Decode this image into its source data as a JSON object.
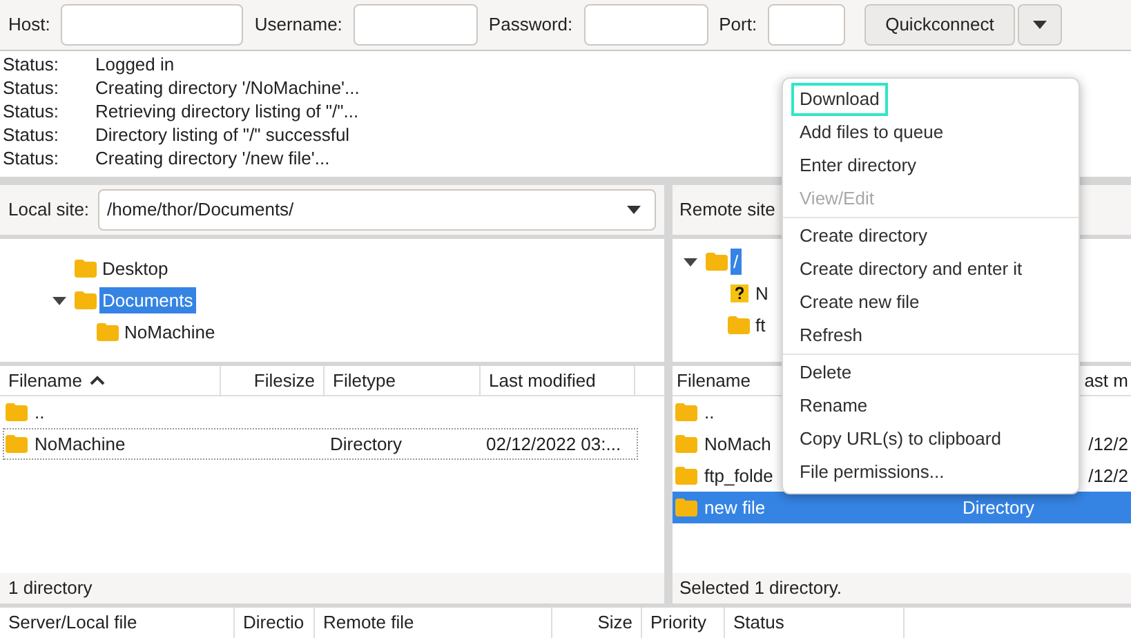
{
  "toolbar": {
    "fields": [
      {
        "label": "Host:"
      },
      {
        "label": "Username:"
      },
      {
        "label": "Password:"
      },
      {
        "label": "Port:"
      }
    ],
    "quickconnect": "Quickconnect"
  },
  "log": [
    {
      "label": "Status:",
      "message": "Logged in"
    },
    {
      "label": "Status:",
      "message": "Creating directory '/NoMachine'..."
    },
    {
      "label": "Status:",
      "message": "Retrieving directory listing of \"/\"..."
    },
    {
      "label": "Status:",
      "message": "Directory listing of \"/\" successful"
    },
    {
      "label": "Status:",
      "message": "Creating directory '/new file'..."
    }
  ],
  "local": {
    "site_label": "Local site:",
    "path": "/home/thor/Documents/",
    "tree": [
      {
        "name": "Desktop",
        "expanded": false,
        "selected": false,
        "kind": "folder"
      },
      {
        "name": "Documents",
        "expanded": true,
        "selected": true,
        "kind": "folder",
        "children": [
          {
            "name": "NoMachine",
            "expanded": false,
            "selected": false,
            "kind": "folder"
          }
        ]
      }
    ],
    "columns": [
      {
        "label": "Filename",
        "sorted": true
      },
      {
        "label": "Filesize",
        "sorted": false
      },
      {
        "label": "Filetype",
        "sorted": false
      },
      {
        "label": "Last modified",
        "sorted": false
      }
    ],
    "rows": [
      {
        "cells": [
          "..",
          "",
          "",
          ""
        ],
        "focused": false,
        "selected": false
      },
      {
        "cells": [
          "NoMachine",
          "",
          "Directory",
          "02/12/2022 03:..."
        ],
        "focused": true,
        "selected": false
      }
    ],
    "status": "1 directory"
  },
  "remote": {
    "site_label": "Remote site",
    "tree": [
      {
        "name": "/",
        "expanded": true,
        "selected": true,
        "kind": "folder",
        "children": [
          {
            "name": "N",
            "expanded": false,
            "selected": false,
            "kind": "unknown"
          },
          {
            "name": "ft",
            "expanded": false,
            "selected": false,
            "kind": "folder"
          }
        ]
      }
    ],
    "columns": [
      "Filename",
      "",
      "ast m"
    ],
    "rows": [
      {
        "cells": [
          "..",
          "",
          ""
        ],
        "selected": false
      },
      {
        "cells": [
          "NoMach",
          "",
          "/12/2"
        ],
        "selected": false
      },
      {
        "cells": [
          "ftp_folde",
          "",
          "/12/2"
        ],
        "selected": false
      },
      {
        "cells": [
          "new file",
          "Directory",
          ""
        ],
        "selected": true
      }
    ],
    "status": "Selected 1 directory."
  },
  "queue": {
    "columns": [
      "Server/Local file",
      "Directio",
      "Remote file",
      "Size",
      "Priority",
      "Status"
    ]
  },
  "context_menu": {
    "groups": [
      [
        {
          "label": "Download",
          "disabled": false,
          "highlighted": true
        },
        {
          "label": "Add files to queue",
          "disabled": false,
          "highlighted": false
        },
        {
          "label": "Enter directory",
          "disabled": false,
          "highlighted": false
        },
        {
          "label": "View/Edit",
          "disabled": true,
          "highlighted": false
        }
      ],
      [
        {
          "label": "Create directory",
          "disabled": false,
          "highlighted": false
        },
        {
          "label": "Create directory and enter it",
          "disabled": false,
          "highlighted": false
        },
        {
          "label": "Create new file",
          "disabled": false,
          "highlighted": false
        },
        {
          "label": "Refresh",
          "disabled": false,
          "highlighted": false
        }
      ],
      [
        {
          "label": "Delete",
          "disabled": false,
          "highlighted": false
        },
        {
          "label": "Rename",
          "disabled": false,
          "highlighted": false
        },
        {
          "label": "Copy URL(s) to clipboard",
          "disabled": false,
          "highlighted": false
        },
        {
          "label": "File permissions...",
          "disabled": false,
          "highlighted": false
        }
      ]
    ]
  }
}
